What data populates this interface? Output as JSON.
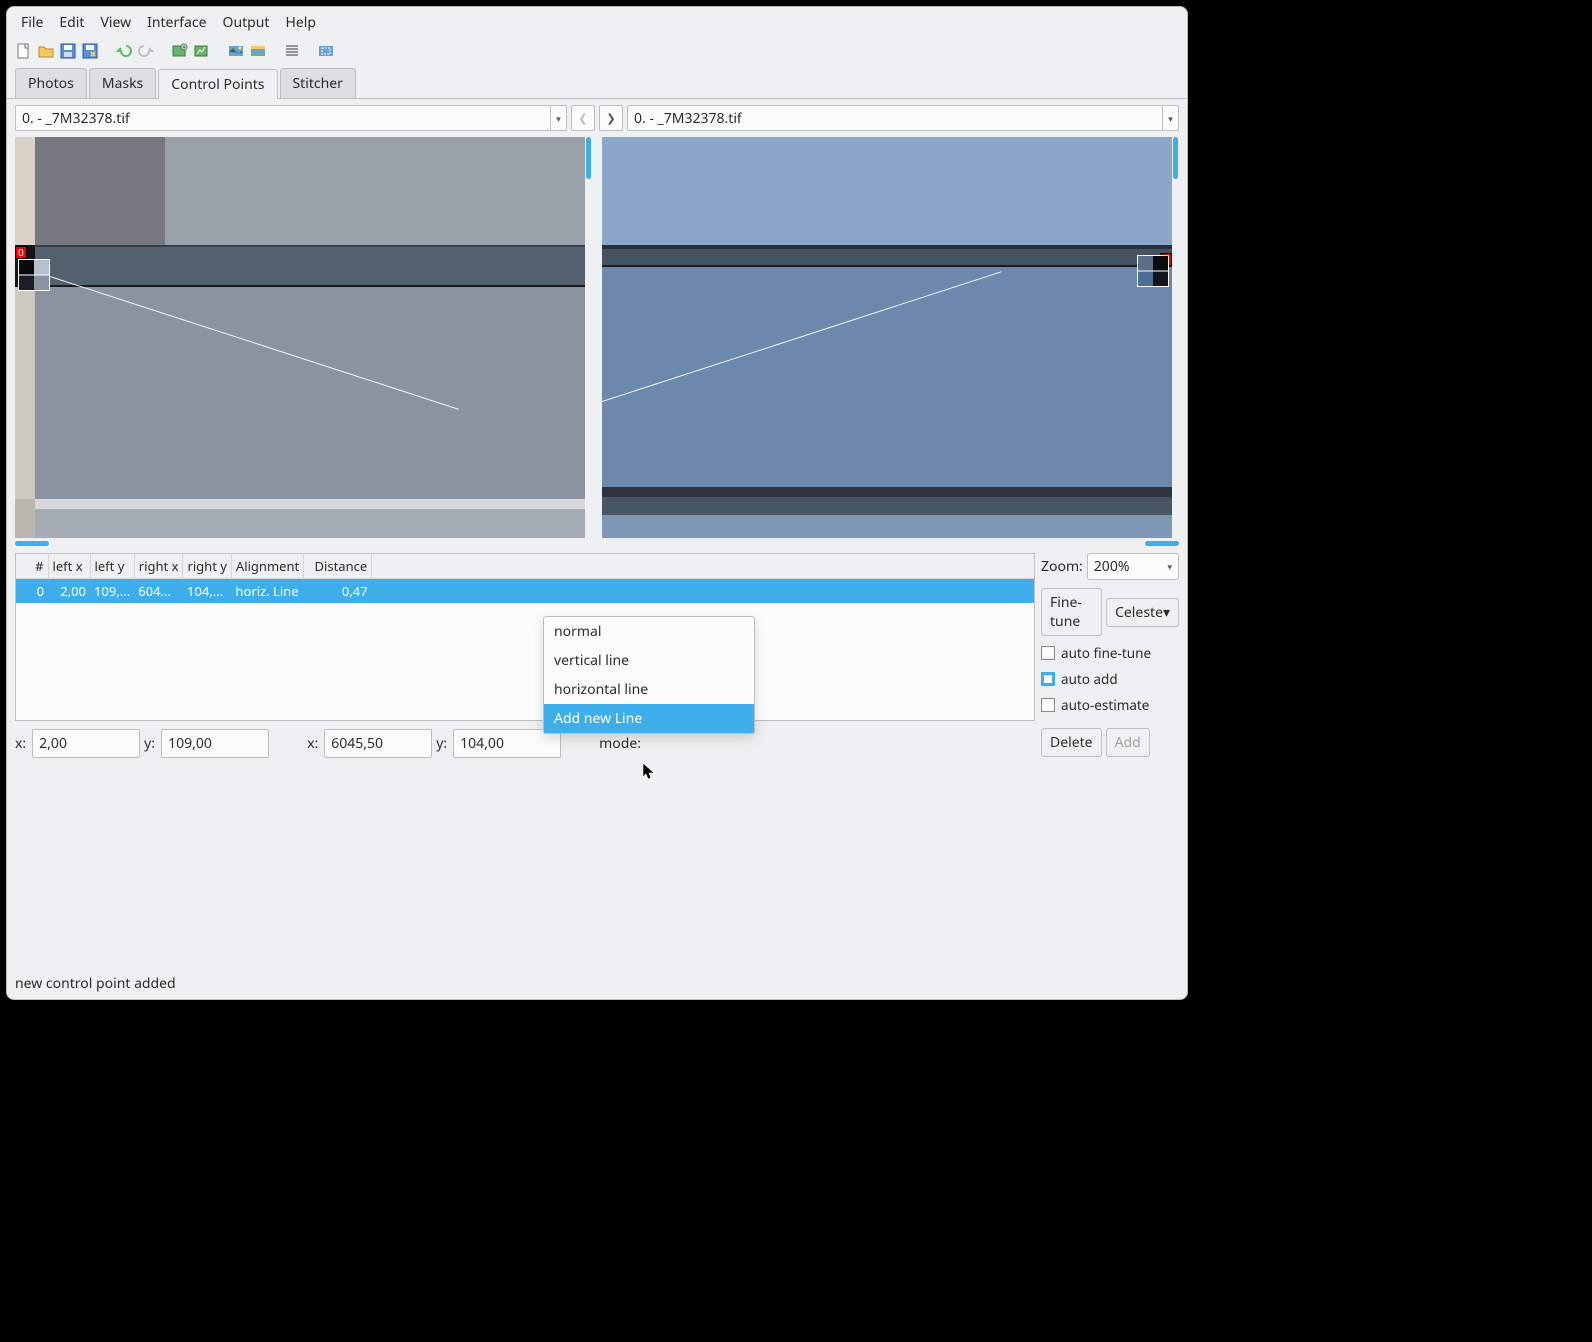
{
  "menu": {
    "file": "File",
    "edit": "Edit",
    "view": "View",
    "interface": "Interface",
    "output": "Output",
    "help": "Help"
  },
  "tabs": {
    "photos": "Photos",
    "masks": "Masks",
    "control_points": "Control Points",
    "stitcher": "Stitcher"
  },
  "image_selector": {
    "left": "0. - _7M32378.tif",
    "right": "0. - _7M32378.tif"
  },
  "cp_marker_label": "0",
  "cp_table": {
    "headers": {
      "num": "#",
      "left_x": "left x",
      "left_y": "left y",
      "right_x": "right x",
      "right_y": "right y",
      "alignment": "Alignment",
      "distance": "Distance"
    },
    "rows": [
      {
        "num": "0",
        "left_x": "2,00",
        "left_y": "109,...",
        "right_x": "604...",
        "right_y": "104,...",
        "alignment": "horiz. Line",
        "distance": "0,47"
      }
    ]
  },
  "zoom": {
    "label": "Zoom:",
    "value": "200%"
  },
  "buttons": {
    "fine_tune": "Fine-tune",
    "celeste": "Celeste▾",
    "delete": "Delete",
    "add": "Add"
  },
  "checks": {
    "auto_fine_tune": "auto fine-tune",
    "auto_add": "auto add",
    "auto_estimate": "auto-estimate"
  },
  "coords": {
    "x1_label": "x:",
    "x1": "2,00",
    "y1_label": "y:",
    "y1": "109,00",
    "x2_label": "x:",
    "x2": "6045,50",
    "y2_label": "y:",
    "y2": "104,00",
    "mode_label": "mode:"
  },
  "mode_options": {
    "normal": "normal",
    "vertical": "vertical line",
    "horizontal": "horizontal line",
    "add_new": "Add new Line"
  },
  "status": "new control point added"
}
